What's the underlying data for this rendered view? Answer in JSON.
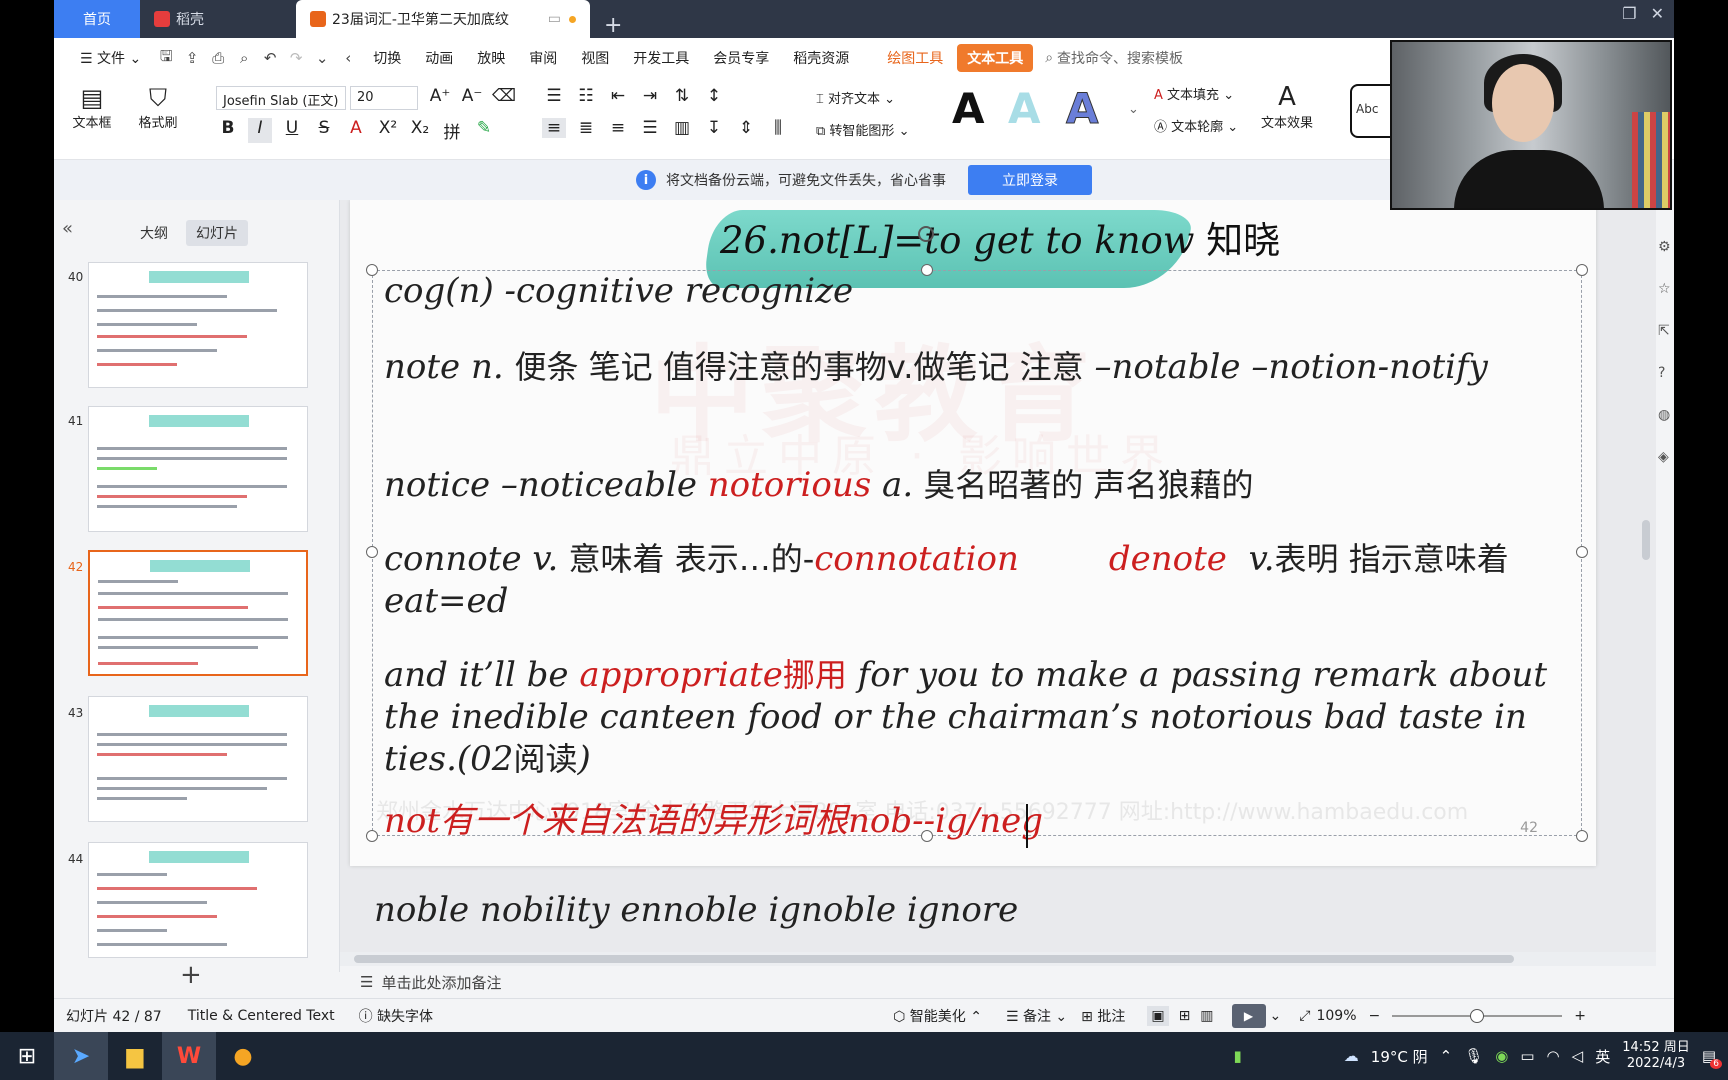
{
  "tabs": {
    "home": "首页",
    "daoke": "稻壳",
    "doc": "23届词汇-卫华第二天加底纹"
  },
  "menu": {
    "file": "文件",
    "items": [
      "切换",
      "动画",
      "放映",
      "审阅",
      "视图",
      "开发工具",
      "会员专享",
      "稻壳资源"
    ],
    "draw_tool": "绘图工具",
    "text_tool": "文本工具",
    "search": "查找命令、搜索模板"
  },
  "ribbon": {
    "textbox": "文本框",
    "format_painter": "格式刷",
    "font": "Josefin Slab (正文)",
    "size": "20",
    "align_text": "对齐文本",
    "convert_shape": "转智能图形",
    "text_fill": "文本填充",
    "text_outline": "文本轮廓",
    "text_effect": "文本效果",
    "abc": "Abc",
    "big_a": "A"
  },
  "cloud": {
    "message": "将文档备份云端，可避免文件丢失，省心省事",
    "login": "立即登录"
  },
  "left_panel": {
    "outline": "大纲",
    "slides": "幻灯片",
    "thumbs": [
      {
        "num": "40"
      },
      {
        "num": "41"
      },
      {
        "num": "42"
      },
      {
        "num": "43"
      },
      {
        "num": "44"
      }
    ]
  },
  "slide": {
    "title": "26.not[L]=to get to know",
    "title_cn": "知晓",
    "watermark_big": "中聚教育",
    "watermark_sub": "鼎立中原 · 影响世界",
    "footer_wm": "郑州金水万达中心2918室/金水东路卫华大厦801室  电话:0371-55692777  网址:http://www.hambaedu.com",
    "line1": "cog(n) -cognitive recognize",
    "line2a": "note n.",
    "line2b": "便条 笔记 值得注意的事物v.做笔记 注意",
    "line2c": " –notable –notion-notify",
    "line3a": "notice –noticeable ",
    "line3b": "notorious",
    "line3c": " a.",
    "line3d": " 臭名昭著的 声名狼藉的",
    "line4a": "connote v.",
    "line4b": " 意味着 表示…的-",
    "line4c": "connotation",
    "line4d": "denote",
    "line4e": "v.",
    "line4f": "表明 指示意味着",
    "line4g": " eat=ed",
    "line5a": "and it’ll be ",
    "line5b": "appropriate",
    "line5c": "挪用",
    "line5d": " for you to make a passing remark about the inedible canteen food or the chairman’s notorious bad taste in ties.(02",
    "line5e": "阅读",
    "line5f": ")",
    "line6": "not有一个来自法语的异形词根nob--ig/neg",
    "slide_num": "42",
    "below": "noble   nobility ennoble ignoble    ignore"
  },
  "notes": "单击此处添加备注",
  "status": {
    "slide": "幻灯片 42 / 87",
    "layout": "Title & Centered Text",
    "missing_font": "缺失字体",
    "beautify": "智能美化",
    "notes": "备注",
    "comment": "批注",
    "zoom": "109%"
  },
  "taskbar": {
    "weather": "19°C 阴",
    "ime": "英",
    "time": "14:52 周日",
    "date": "2022/4/3",
    "badge": "6"
  },
  "colors": {
    "accent": "#3d7ef2",
    "text_tool": "#f07a2c",
    "red_text": "#cc1f1f",
    "brush": "#4fc4b3"
  }
}
